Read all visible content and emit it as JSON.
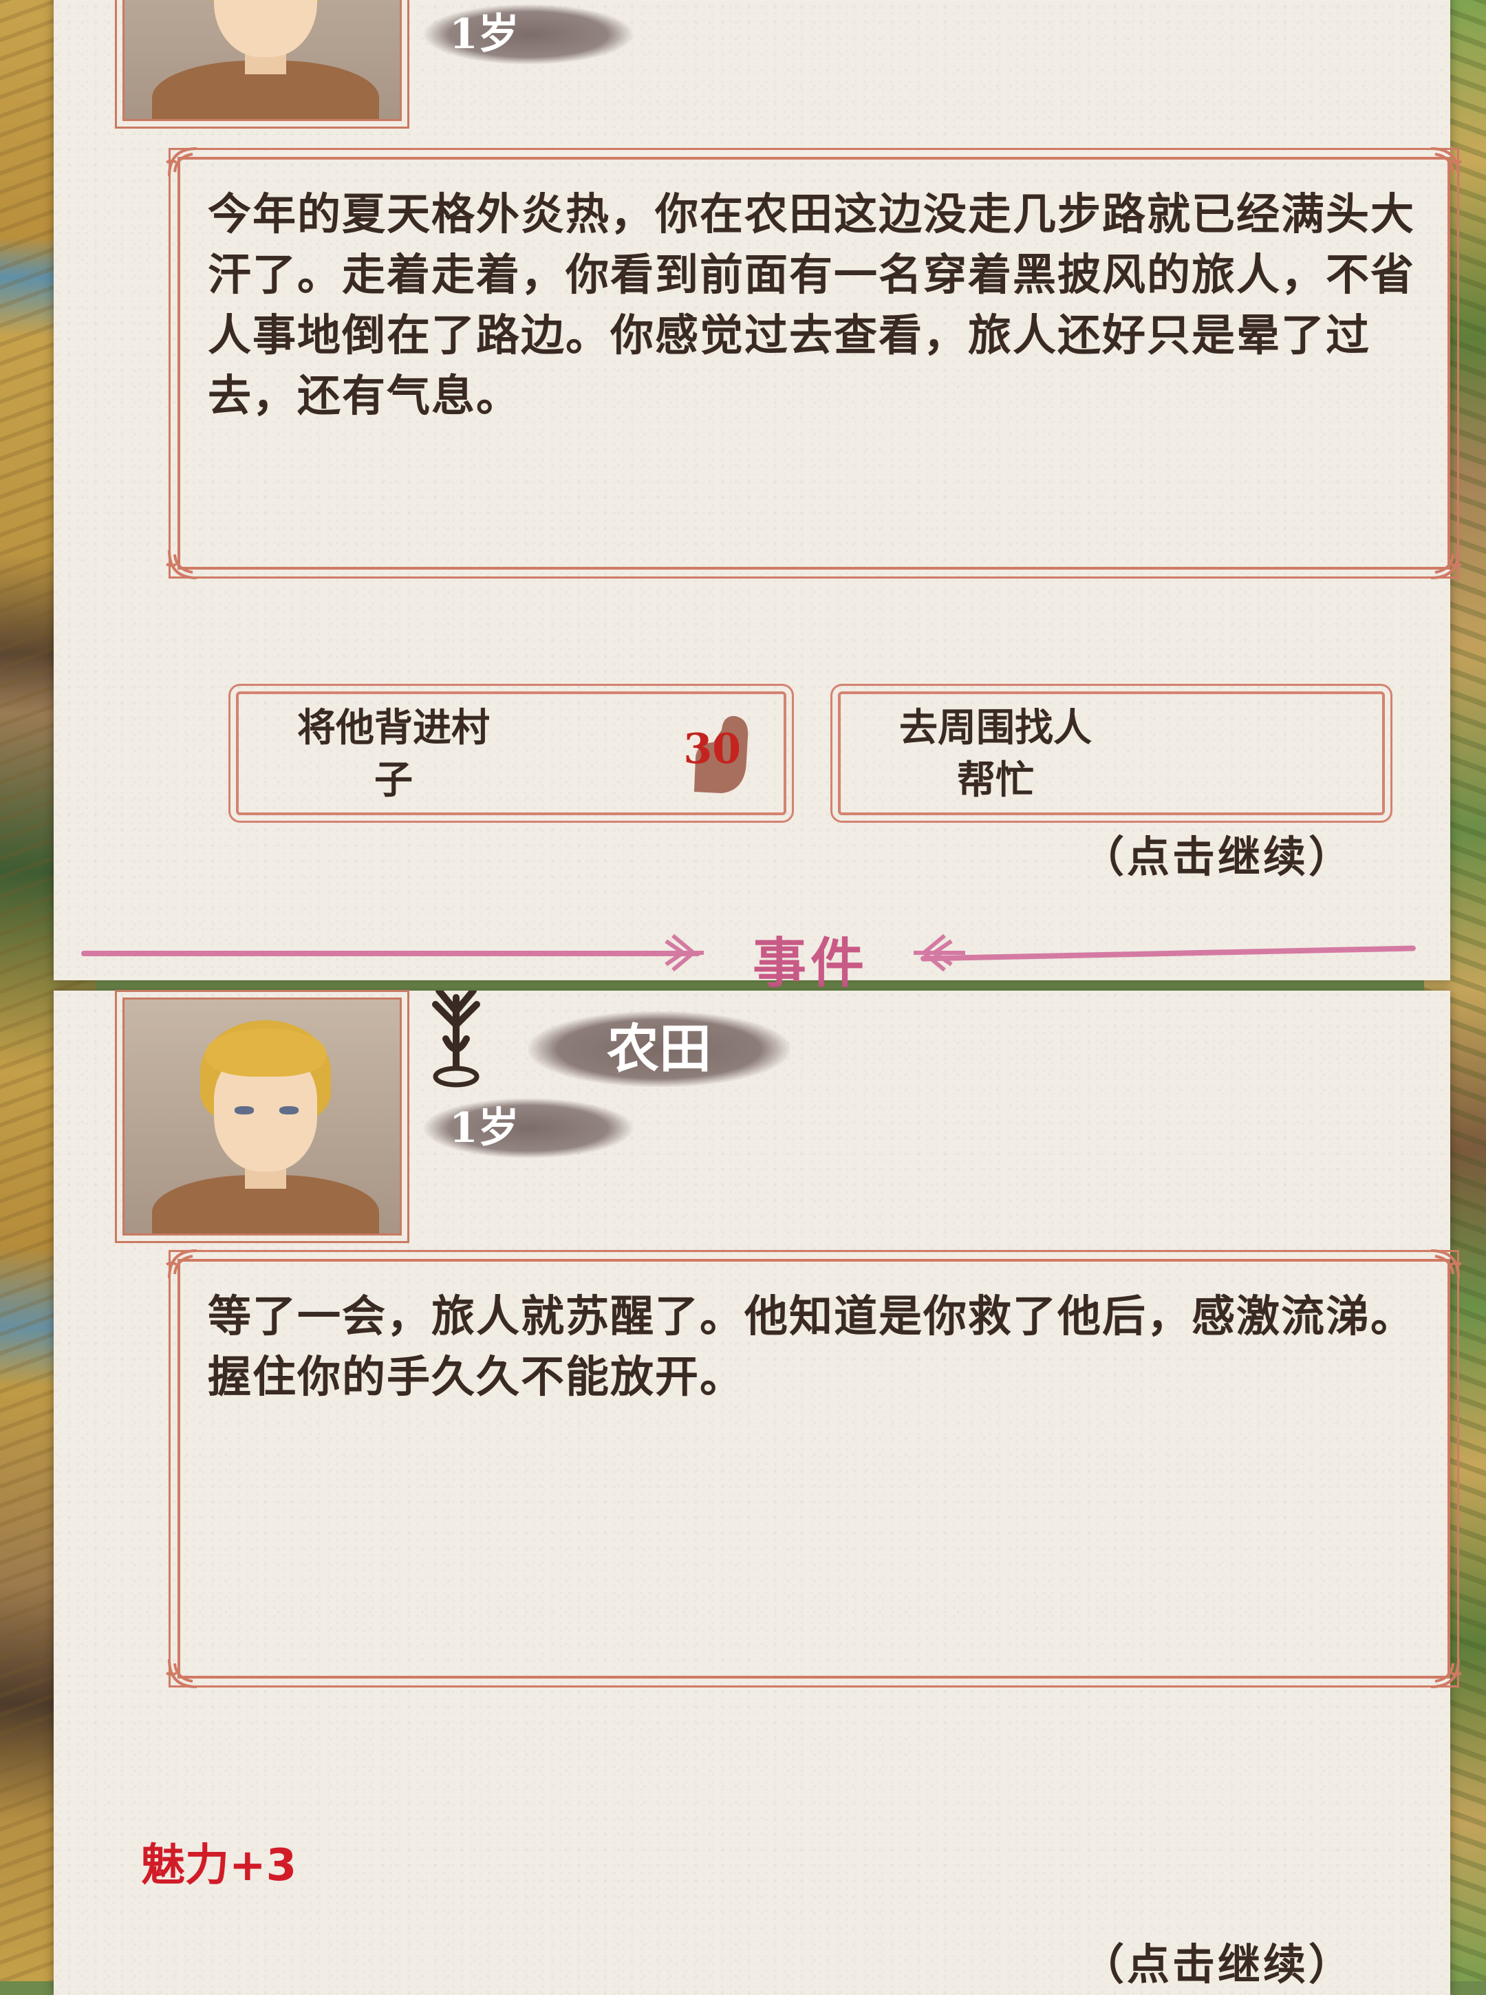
{
  "top_card": {
    "age": "1岁",
    "story": "今年的夏天格外炎热，你在农田这边没走几步路就已经满头大汗了。走着走着，你看到前面有一名穿着黑披风的旅人，不省人事地倒在了路边。你感觉过去查看，旅人还好只是晕了过去，还有气息。",
    "choices": [
      {
        "label_line1": "将他背进村",
        "label_line2": "子",
        "requirement_icon": "strength-arm-icon",
        "requirement_value": "30"
      },
      {
        "label_line1": "去周围找人",
        "label_line2": "帮忙"
      }
    ],
    "continue": "（点击继续）"
  },
  "divider": {
    "title": "事件"
  },
  "bottom_card": {
    "location": "农田",
    "location_icon": "location-pin-icon",
    "age": "1岁",
    "story": "等了一会，旅人就苏醒了。他知道是你救了他后，感激流涕。握住你的手久久不能放开。",
    "reward": "魅力+3",
    "continue": "（点击继续）"
  },
  "colors": {
    "parchment": "#f1ece4",
    "frame": "#d07a64",
    "divider": "#d47aa2",
    "reward": "#d11c28",
    "strength_value": "#c4231f"
  }
}
